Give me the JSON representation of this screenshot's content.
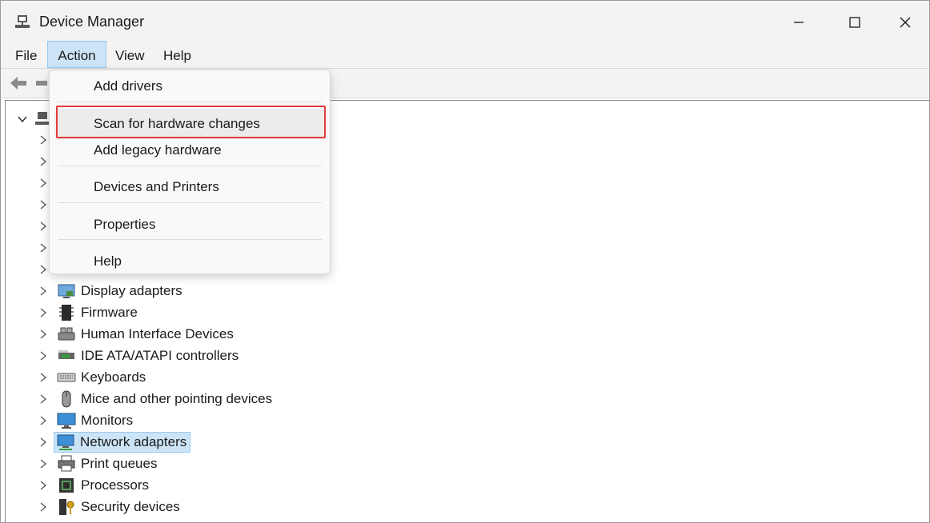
{
  "window": {
    "title": "Device Manager",
    "app_icon": "device-manager-icon"
  },
  "menubar": {
    "file": "File",
    "action": "Action",
    "view": "View",
    "help": "Help"
  },
  "action_menu": {
    "items": [
      {
        "label": "Add drivers"
      },
      {
        "label": "Scan for hardware changes"
      },
      {
        "label": "Add legacy hardware"
      },
      {
        "label": "Devices and Printers"
      },
      {
        "label": "Properties"
      },
      {
        "label": "Help"
      }
    ],
    "highlighted": "Scan for hardware changes",
    "highlight_color": "#e23b3b"
  },
  "tree": {
    "categories": [
      {
        "label": "Display adapters",
        "icon": "display-adapter-icon"
      },
      {
        "label": "Firmware",
        "icon": "firmware-icon"
      },
      {
        "label": "Human Interface Devices",
        "icon": "hid-icon"
      },
      {
        "label": "IDE ATA/ATAPI controllers",
        "icon": "ide-controller-icon"
      },
      {
        "label": "Keyboards",
        "icon": "keyboard-icon"
      },
      {
        "label": "Mice and other pointing devices",
        "icon": "mouse-icon"
      },
      {
        "label": "Monitors",
        "icon": "monitor-icon"
      },
      {
        "label": "Network adapters",
        "icon": "network-adapter-icon"
      },
      {
        "label": "Print queues",
        "icon": "printer-icon"
      },
      {
        "label": "Processors",
        "icon": "processor-icon"
      },
      {
        "label": "Security devices",
        "icon": "security-device-icon"
      }
    ],
    "selected": "Network adapters",
    "selection_color": "#cce4f7"
  }
}
